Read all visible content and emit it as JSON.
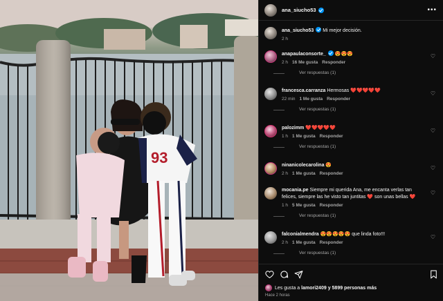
{
  "post": {
    "username": "ana_siucho53",
    "caption_user": "ana_siucho53",
    "caption_text": "Mi mejor decisión.",
    "caption_time": "2 h",
    "photo": {
      "jersey_number": "93"
    }
  },
  "comments": [
    {
      "user": "anapaulaconsorte_",
      "verified": true,
      "text": "😍😍😍",
      "time": "2 h",
      "likes": "16 Me gusta",
      "reply": "Responder",
      "replies": "Ver respuestas (1)"
    },
    {
      "user": "francesca.carranza",
      "verified": false,
      "text": "Hermosas ❤️❤️❤️❤️❤️",
      "time": "22 min",
      "likes": "1 Me gusta",
      "reply": "Responder",
      "replies": "Ver respuestas (1)"
    },
    {
      "user": "palozimm",
      "verified": false,
      "text": "❤️❤️❤️❤️❤️",
      "time": "1 h",
      "likes": "1 Me gusta",
      "reply": "Responder",
      "replies": "Ver respuestas (1)"
    },
    {
      "user": "ninanicolecarolina",
      "verified": false,
      "text": "😍",
      "time": "2 h",
      "likes": "1 Me gusta",
      "reply": "Responder",
      "replies": ""
    },
    {
      "user": "mocania.pe",
      "verified": false,
      "text": "Siempre mi querida Ana, me encanta verlas tan felices, siempre las he visto tan juntitas ❤️ son unas bellas ❤️",
      "time": "1 h",
      "likes": "5 Me gusta",
      "reply": "Responder",
      "replies": "Ver respuestas (1)"
    },
    {
      "user": "falconialmendra",
      "verified": false,
      "text": "😍😍😍😍😍 que linda foto!!!",
      "time": "2 h",
      "likes": "1 Me gusta",
      "reply": "Responder",
      "replies": "Ver respuestas (1)"
    }
  ],
  "footer": {
    "likes_prefix": "Les gusta a",
    "likes_user": "lamori2409",
    "likes_suffix": "y 5899 personas más",
    "time": "Hace 2 horas"
  },
  "icons": {
    "more": "more-horizontal-icon",
    "like": "heart-icon",
    "comment": "comment-icon",
    "share": "send-icon",
    "save": "bookmark-icon"
  },
  "colors": {
    "verified": "#0095f6",
    "background": "#000000",
    "muted_text": "#a8a8a8"
  }
}
